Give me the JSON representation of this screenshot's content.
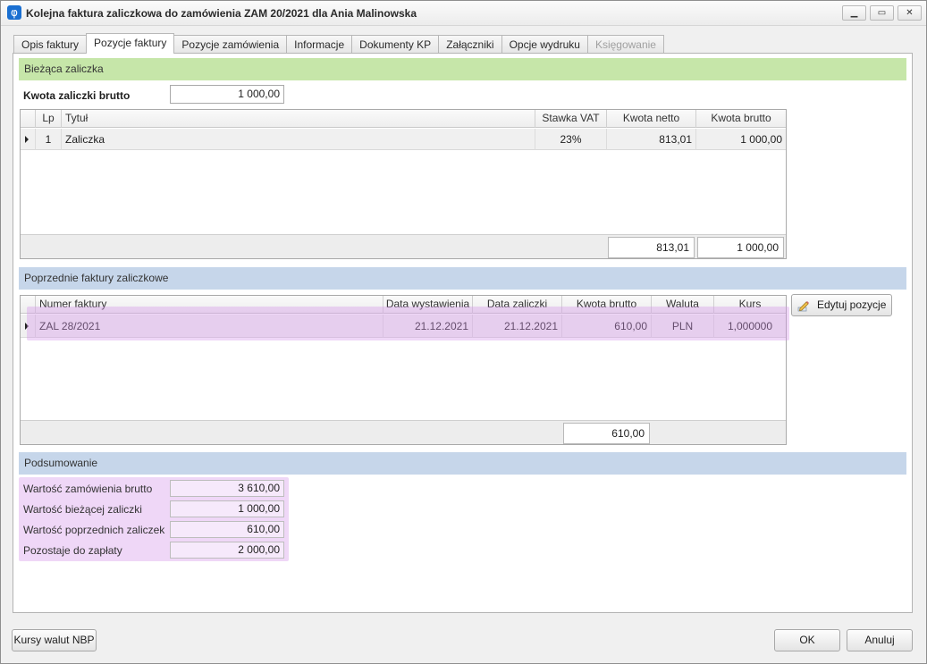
{
  "window": {
    "title": "Kolejna faktura zaliczkowa do zamówienia ZAM 20/2021 dla Ania Malinowska",
    "app_icon_glyph": "φ",
    "minimize_glyph": "▁",
    "maximize_glyph": "▭",
    "close_glyph": "✕"
  },
  "tabs": [
    {
      "label": "Opis faktury"
    },
    {
      "label": "Pozycje faktury",
      "active": true
    },
    {
      "label": "Pozycje zamówienia"
    },
    {
      "label": "Informacje"
    },
    {
      "label": "Dokumenty KP"
    },
    {
      "label": "Załączniki"
    },
    {
      "label": "Opcje wydruku"
    },
    {
      "label": "Księgowanie",
      "disabled": true
    }
  ],
  "current": {
    "header": "Bieżąca zaliczka",
    "amount_label": "Kwota zaliczki brutto",
    "amount_value": "1 000,00",
    "columns": [
      "Lp",
      "Tytuł",
      "Stawka VAT",
      "Kwota netto",
      "Kwota brutto"
    ],
    "rows": [
      {
        "lp": "1",
        "title": "Zaliczka",
        "vat": "23%",
        "net": "813,01",
        "gross": "1 000,00"
      }
    ],
    "total_net": "813,01",
    "total_gross": "1 000,00"
  },
  "previous": {
    "header": "Poprzednie faktury zaliczkowe",
    "columns": [
      "Numer faktury",
      "Data wystawienia",
      "Data zaliczki",
      "Kwota brutto",
      "Waluta",
      "Kurs"
    ],
    "rows": [
      {
        "number": "ZAL 28/2021",
        "issue_date": "21.12.2021",
        "advance_date": "21.12.2021",
        "gross": "610,00",
        "currency": "PLN",
        "rate": "1,000000"
      }
    ],
    "total_gross": "610,00",
    "edit_button": "Edytuj pozycje"
  },
  "summary": {
    "header": "Podsumowanie",
    "items": [
      {
        "label": "Wartość zamówienia brutto",
        "value": "3 610,00"
      },
      {
        "label": "Wartość bieżącej zaliczki",
        "value": "1 000,00"
      },
      {
        "label": "Wartość poprzednich zaliczek",
        "value": "610,00"
      },
      {
        "label": "Pozostaje do zapłaty",
        "value": "2 000,00"
      }
    ]
  },
  "buttons": {
    "nbp": "Kursy walut NBP",
    "ok": "OK",
    "cancel": "Anuluj"
  },
  "colors": {
    "green_header": "#c6e6a9",
    "blue_header": "#c6d6ea",
    "highlight": "#d696eb",
    "arrow": "#c236a8"
  }
}
